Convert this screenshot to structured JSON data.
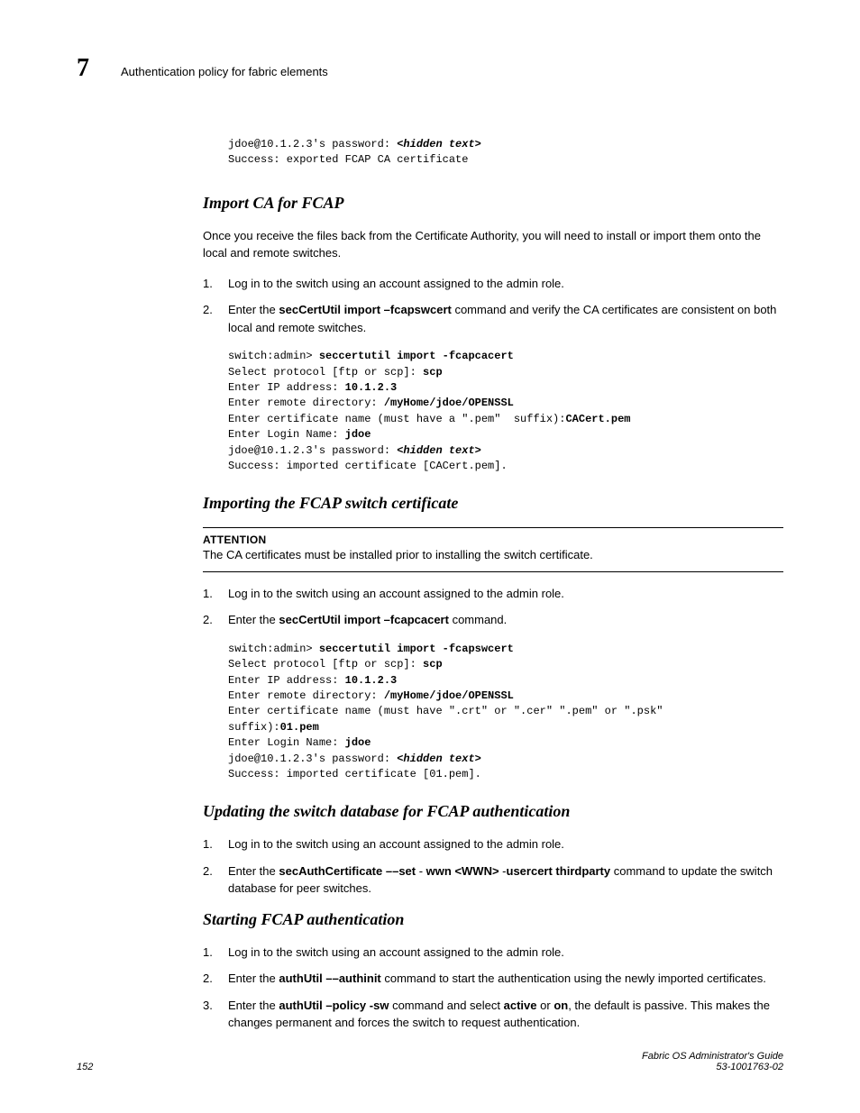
{
  "header": {
    "chapter": "7",
    "title": "Authentication policy for fabric elements"
  },
  "topCode": {
    "l1a": "jdoe@10.1.2.3's password: ",
    "l1b": "<hidden text>",
    "l2": "Success: exported FCAP CA certificate"
  },
  "sec1": {
    "heading": "Import CA for FCAP",
    "intro": "Once you receive the files back from the Certificate Authority, you will need to install or import them onto the local and remote switches.",
    "step1": "Log in to the switch using an account assigned to the admin role.",
    "step2a": "Enter the ",
    "step2b": "secCertUtil import –fcapswcert",
    "step2c": " command and verify the CA certificates are consistent on both local and remote switches.",
    "code": {
      "l1a": "switch:admin> ",
      "l1b": "seccertutil import -fcapcacert",
      "l2a": "Select protocol [ftp or scp]: ",
      "l2b": "scp",
      "l3a": "Enter IP address: ",
      "l3b": "10.1.2.3",
      "l4a": "Enter remote directory: ",
      "l4b": "/myHome/jdoe/OPENSSL",
      "l5a": "Enter certificate name (must have a \".pem\"  suffix):",
      "l5b": "CACert.pem",
      "l6a": "Enter Login Name: ",
      "l6b": "jdoe",
      "l7a": "jdoe@10.1.2.3's password: ",
      "l7b": "<hidden text>",
      "l8": "Success: imported certificate [CACert.pem]."
    }
  },
  "sec2": {
    "heading": "Importing the FCAP switch certificate",
    "attTitle": "ATTENTION",
    "attBody": "The CA certificates must be installed prior to installing the switch certificate.",
    "step1": "Log in to the switch using an account assigned to the admin role.",
    "step2a": "Enter the ",
    "step2b": "secCertUtil import –fcapcacert",
    "step2c": " command.",
    "code": {
      "l1a": "switch:admin> ",
      "l1b": "seccertutil import -fcapswcert",
      "l2a": "Select protocol [ftp or scp]: ",
      "l2b": "scp",
      "l3a": "Enter IP address: ",
      "l3b": "10.1.2.3",
      "l4a": "Enter remote directory: ",
      "l4b": "/myHome/jdoe/OPENSSL",
      "l5": "Enter certificate name (must have \".crt\" or \".cer\" \".pem\" or \".psk\" ",
      "l6a": "suffix):",
      "l6b": "01.pem",
      "l7a": "Enter Login Name: ",
      "l7b": "jdoe",
      "l8a": "jdoe@10.1.2.3's password: ",
      "l8b": "<hidden text>",
      "l9": "Success: imported certificate [01.pem]."
    }
  },
  "sec3": {
    "heading": "Updating the switch database for FCAP authentication",
    "step1": "Log in to the switch using an account assigned to the admin role.",
    "step2a": "Enter the ",
    "step2b": "secAuthCertificate ––set",
    "step2c": " - ",
    "step2d": "wwn <WWN>",
    "step2e": " -",
    "step2f": "usercert thirdparty",
    "step2g": " command to update the switch database for peer switches."
  },
  "sec4": {
    "heading": "Starting FCAP authentication",
    "step1": "Log in to the switch using an account assigned to the admin role.",
    "step2a": "Enter the ",
    "step2b": "authUtil ––authinit",
    "step2c": " command to start the authentication using the newly imported certificates.",
    "step3a": "Enter the ",
    "step3b": "authUtil –policy -sw",
    "step3c": " command and select ",
    "step3d": "active",
    "step3e": " or ",
    "step3f": "on",
    "step3g": ", the default is passive. This makes the changes permanent and forces the switch to request authentication."
  },
  "footer": {
    "page": "152",
    "guide": "Fabric OS Administrator's Guide",
    "docnum": "53-1001763-02"
  }
}
